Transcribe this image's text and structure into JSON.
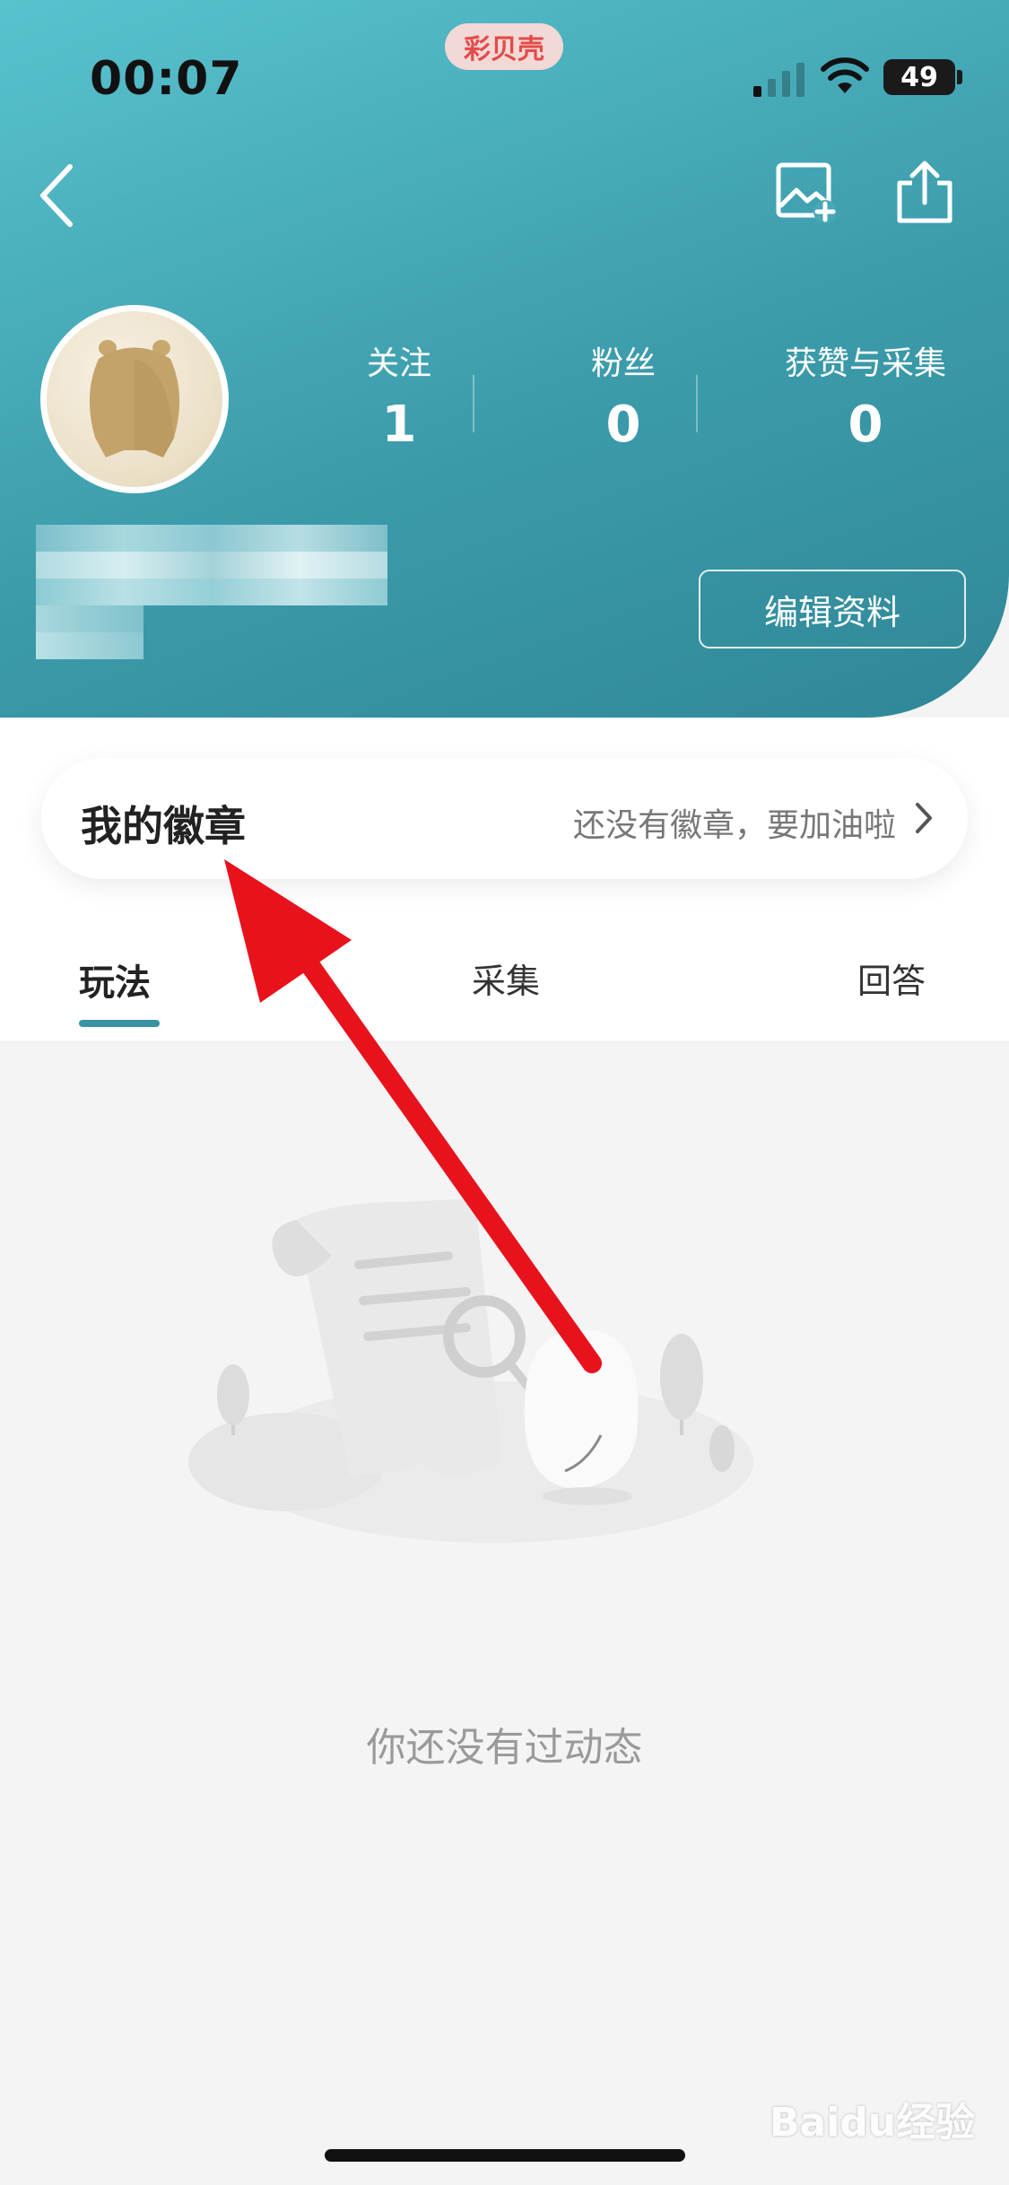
{
  "status_bar": {
    "time": "00:07",
    "app_badge": "彩贝壳",
    "battery": "49"
  },
  "profile": {
    "stats": [
      {
        "label": "关注",
        "value": "1"
      },
      {
        "label": "粉丝",
        "value": "0"
      },
      {
        "label": "获赞与采集",
        "value": "0"
      }
    ],
    "edit_label": "编辑资料"
  },
  "badges": {
    "title": "我的徽章",
    "hint": "还没有徽章，要加油啦"
  },
  "tabs": [
    {
      "label": "玩法"
    },
    {
      "label": "采集"
    },
    {
      "label": "回答"
    }
  ],
  "empty_state": {
    "text": "你还没有过动态"
  },
  "watermark": {
    "text": "Baidu经验"
  },
  "colors": {
    "header_start": "#59c2cf",
    "header_end": "#2f8797",
    "accent": "#3a93a3",
    "arrow": "#e8121c"
  }
}
